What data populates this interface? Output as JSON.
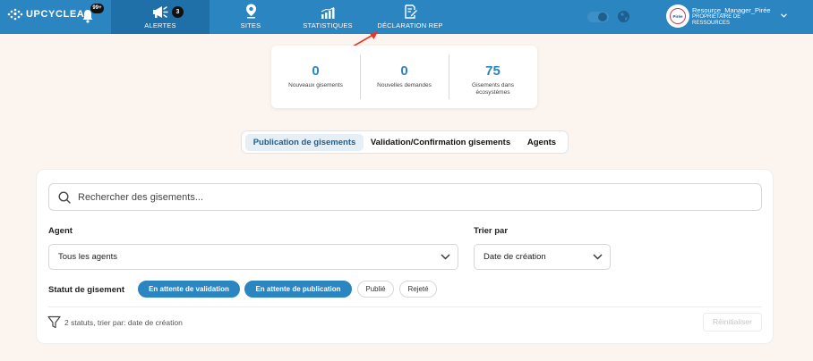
{
  "header": {
    "brand": "UPCYCLEA",
    "notifications_badge": "99+",
    "nav": [
      {
        "label": "ALERTES",
        "badge": "3",
        "icon": "megaphone-icon",
        "active": true
      },
      {
        "label": "SITES",
        "icon": "location-pin-icon"
      },
      {
        "label": "STATISTIQUES",
        "icon": "bar-chart-icon"
      },
      {
        "label": "DÉCLARATION REP",
        "icon": "document-edit-icon"
      }
    ],
    "user": {
      "name": "Resource_Manager_Pirée",
      "role": "PROPRIÉTAIRE DE RESSOURCES",
      "avatar_text": "Pirée"
    },
    "colors": {
      "bar": "#2a85c0",
      "active_item": "#1f70a8"
    }
  },
  "stats": [
    {
      "value": "0",
      "label": "Nouveaux gisements"
    },
    {
      "value": "0",
      "label": "Nouvelles demandes"
    },
    {
      "value": "75",
      "label": "Gisements dans écosystèmes"
    }
  ],
  "tabs": [
    {
      "label": "Publication de gisements",
      "active": true
    },
    {
      "label": "Validation/Confirmation gisements"
    },
    {
      "label": "Agents"
    }
  ],
  "search": {
    "placeholder": "Rechercher des gisements..."
  },
  "filters": {
    "agent_label": "Agent",
    "agent_value": "Tous les agents",
    "sort_label": "Trier par",
    "sort_value": "Date de création",
    "status_label": "Statut de gisement",
    "status_chips": [
      {
        "label": "En attente de validation",
        "selected": true
      },
      {
        "label": "En attente de publication",
        "selected": true
      },
      {
        "label": "Publié",
        "selected": false
      },
      {
        "label": "Rejeté",
        "selected": false
      }
    ],
    "summary": "2 statuts, trier par: date de création",
    "reset_label": "Réinitialiser"
  }
}
